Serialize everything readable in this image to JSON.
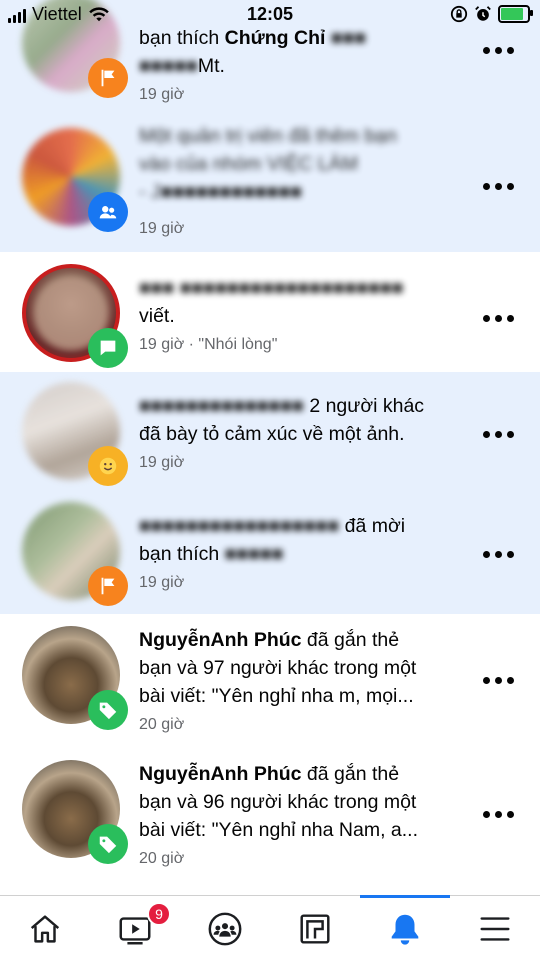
{
  "status_bar": {
    "carrier": "Viettel",
    "time": "12:05",
    "battery_color": "#34c759",
    "icons": [
      "signal-icon",
      "wifi-icon",
      "orientation-lock-icon",
      "alarm-icon",
      "battery-icon"
    ]
  },
  "notifications": [
    {
      "unread": true,
      "text_plain": "bạn thích ",
      "text_bold": "Chứng Chỉ ",
      "line2": "Mt.",
      "time": "19 giờ",
      "badge_color": "#f7831e",
      "badge_icon": "flag-icon"
    },
    {
      "unread": true,
      "line1": "Một quản trị viên đã thêm bạn",
      "line2": "vào của nhóm VIỆC LÀM",
      "line3": "- J",
      "time": "19 giờ",
      "badge_color": "#1877f2",
      "badge_icon": "group-icon"
    },
    {
      "unread": false,
      "line1": "",
      "line2": "viết.",
      "time": "19 giờ · \"Nhói lòng\"",
      "badge_color": "#2abe5c",
      "badge_icon": "comment-icon"
    },
    {
      "unread": true,
      "line1": "2 người khác",
      "line2": "đã bày tỏ cảm xúc về một ảnh.",
      "time": "19 giờ",
      "badge_color": "#f7b125",
      "badge_icon": "reaction-icon"
    },
    {
      "unread": true,
      "line1": "đã mời",
      "line2": "bạn thích",
      "time": "19 giờ",
      "badge_color": "#f7831e",
      "badge_icon": "flag-icon"
    },
    {
      "unread": false,
      "name": "NguyễnAnh Phúc",
      "action": " đã gắn thẻ",
      "line2": "bạn và 97 người khác trong một",
      "line3": "bài viết: \"Yên nghỉ nha m, mọi...",
      "time": "20 giờ",
      "badge_color": "#2abe5c",
      "badge_icon": "tag-icon"
    },
    {
      "unread": false,
      "name": "NguyễnAnh Phúc",
      "action": " đã gắn thẻ",
      "line2": "bạn và 96 người khác trong một",
      "line3": "bài viết: \"Yên nghỉ nha Nam, a...",
      "time": "20 giờ",
      "badge_color": "#2abe5c",
      "badge_icon": "tag-icon"
    }
  ],
  "tab_bar": {
    "accent": "#1877f2",
    "badge_color": "#e41e3f",
    "tabs": [
      {
        "icon": "home-icon",
        "active": false
      },
      {
        "icon": "watch-icon",
        "active": false,
        "badge": "9"
      },
      {
        "icon": "groups-icon",
        "active": false
      },
      {
        "icon": "pages-icon",
        "active": false
      },
      {
        "icon": "bell-icon",
        "active": true
      },
      {
        "icon": "menu-icon",
        "active": false
      }
    ]
  }
}
